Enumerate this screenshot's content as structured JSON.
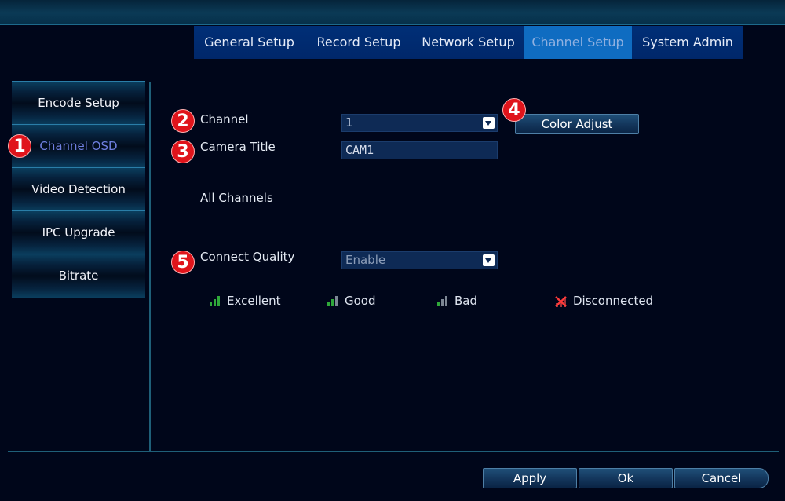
{
  "tabs": [
    {
      "label": "General Setup"
    },
    {
      "label": "Record Setup"
    },
    {
      "label": "Network Setup"
    },
    {
      "label": "Channel Setup"
    },
    {
      "label": "System Admin"
    }
  ],
  "active_tab": "Channel Setup",
  "sidebar": {
    "items": [
      {
        "label": "Encode Setup"
      },
      {
        "label": "Channel OSD"
      },
      {
        "label": "Video Detection"
      },
      {
        "label": "IPC Upgrade"
      },
      {
        "label": "Bitrate"
      }
    ],
    "active_item": "Channel OSD"
  },
  "form": {
    "channel_label": "Channel",
    "channel_value": "1",
    "color_adjust_label": "Color Adjust",
    "camera_title_label": "Camera Title",
    "camera_title_value": "CAM1",
    "all_channels_label": "All Channels",
    "connect_quality_label": "Connect Quality",
    "connect_quality_value": "Enable"
  },
  "legend": {
    "excellent": "Excellent",
    "good": "Good",
    "bad": "Bad",
    "disconnected": "Disconnected"
  },
  "markers": [
    "1",
    "2",
    "3",
    "4",
    "5"
  ],
  "buttons": {
    "apply": "Apply",
    "ok": "Ok",
    "cancel": "Cancel"
  },
  "colors": {
    "background": "#00061a",
    "tab_bar": "#002f77",
    "tab_active": "#0f6cc1",
    "sidebar_active_text": "#6f7fe0",
    "marker_red": "#e0141b",
    "signal_green": "#2fa83a",
    "signal_gray": "#7d8794",
    "disconnected_red": "#d42a2a"
  },
  "icons": [
    "signal-excellent-icon",
    "signal-good-icon",
    "signal-bad-icon",
    "disconnected-icon",
    "dropdown-arrow-icon"
  ]
}
